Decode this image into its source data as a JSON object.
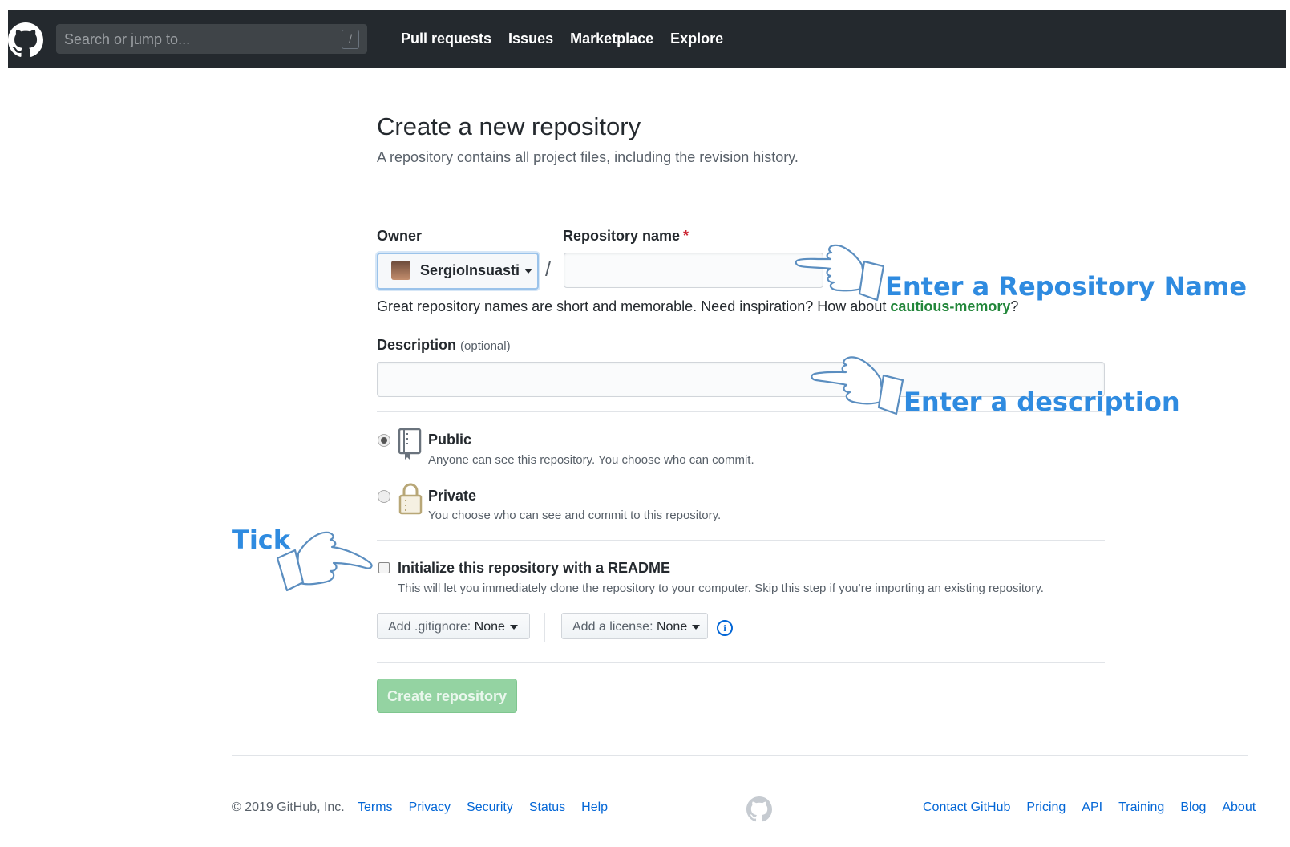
{
  "header": {
    "search_placeholder": "Search or jump to...",
    "search_shortcut": "/",
    "nav": [
      "Pull requests",
      "Issues",
      "Marketplace",
      "Explore"
    ]
  },
  "page": {
    "title": "Create a new repository",
    "subtitle": "A repository contains all project files, including the revision history."
  },
  "form": {
    "owner_label": "Owner",
    "owner_value": "SergioInsuasti",
    "separator": "/",
    "repo_label": "Repository name",
    "required_mark": "*",
    "repo_value": "",
    "hint_prefix": "Great repository names are short and memorable. Need inspiration? How about",
    "hint_suggestion": "cautious-memory",
    "hint_suffix": "?",
    "description_label": "Description",
    "description_optional": "(optional)",
    "description_value": "",
    "visibility": {
      "selected": "public",
      "public_title": "Public",
      "public_desc": "Anyone can see this repository. You choose who can commit.",
      "private_title": "Private",
      "private_desc": "You choose who can see and commit to this repository."
    },
    "readme_checked": false,
    "readme_title": "Initialize this repository with a README",
    "readme_desc": "This will let you immediately clone the repository to your computer. Skip this step if you’re importing an existing repository.",
    "gitignore_label": "Add .gitignore:",
    "gitignore_value": "None",
    "license_label": "Add a license:",
    "license_value": "None",
    "info_glyph": "i",
    "create_button": "Create repository"
  },
  "annotations": {
    "repo_name": "Enter a Repository Name",
    "description": "Enter a description",
    "tick": "Tick",
    "color": "#2f8be0"
  },
  "footer": {
    "copyright": "© 2019 GitHub, Inc.",
    "left_links": [
      "Terms",
      "Privacy",
      "Security",
      "Status",
      "Help"
    ],
    "right_links": [
      "Contact GitHub",
      "Pricing",
      "API",
      "Training",
      "Blog",
      "About"
    ]
  }
}
